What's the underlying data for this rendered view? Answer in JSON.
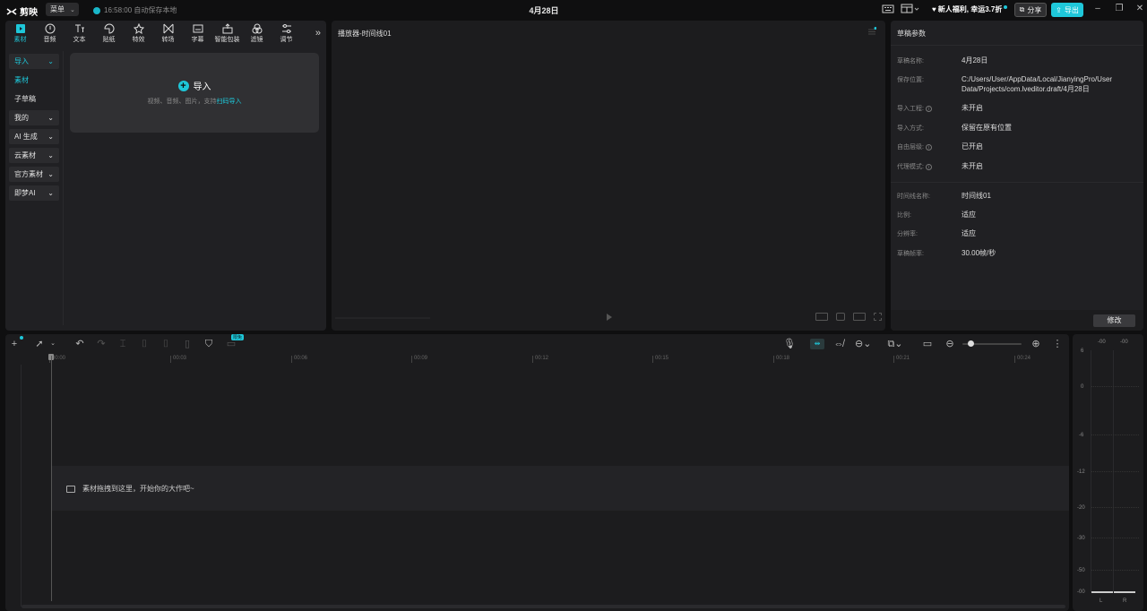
{
  "titlebar": {
    "app_name": "剪映",
    "menu_label": "菜单",
    "autosave_text": "16:58:00 自动保存本地",
    "doc_title": "4月28日",
    "promo_text": "新人福利, 幸运3.7折",
    "share_label": "分享",
    "export_label": "导出"
  },
  "toolbar": {
    "tools": [
      {
        "label": "素材",
        "icon": "media-icon"
      },
      {
        "label": "音频",
        "icon": "audio-icon"
      },
      {
        "label": "文本",
        "icon": "text-icon"
      },
      {
        "label": "贴纸",
        "icon": "sticker-icon"
      },
      {
        "label": "特效",
        "icon": "effects-icon"
      },
      {
        "label": "转场",
        "icon": "transition-icon"
      },
      {
        "label": "字幕",
        "icon": "subtitle-icon"
      },
      {
        "label": "智能包装",
        "icon": "smart-pack-icon"
      },
      {
        "label": "滤镜",
        "icon": "filter-icon"
      },
      {
        "label": "调节",
        "icon": "adjust-icon"
      }
    ],
    "more_label": "»"
  },
  "sidebar": {
    "items": [
      {
        "label": "导入",
        "style": "boxed-teal",
        "chevron": "⌄"
      },
      {
        "label": "素材",
        "style": "teal",
        "chevron": ""
      },
      {
        "label": "子草稿",
        "style": "plain",
        "chevron": ""
      },
      {
        "label": "我的",
        "style": "boxed",
        "chevron": "⌄"
      },
      {
        "label": "AI 生成",
        "style": "boxed",
        "chevron": "⌄"
      },
      {
        "label": "云素材",
        "style": "boxed",
        "chevron": "⌄"
      },
      {
        "label": "官方素材",
        "style": "boxed",
        "chevron": "⌄"
      },
      {
        "label": "即梦AI",
        "style": "boxed",
        "chevron": "⌄"
      }
    ]
  },
  "import_box": {
    "title": "导入",
    "subtitle_prefix": "视频、音频、图片，支持",
    "subtitle_link": "扫码导入"
  },
  "player": {
    "title": "播放器-时间线01"
  },
  "props": {
    "title": "草稿参数",
    "rows": [
      {
        "label": "草稿名称:",
        "value": "4月28日",
        "info": false
      },
      {
        "label": "保存位置:",
        "value": "C:/Users/User/AppData/Local/JianyingPro/User Data/Projects/com.lveditor.draft/4月28日",
        "info": false
      },
      {
        "label": "导入工程:",
        "value": "未开启",
        "info": true
      },
      {
        "label": "导入方式:",
        "value": "保留在原有位置",
        "info": false
      },
      {
        "label": "自由层级:",
        "value": "已开启",
        "info": true
      },
      {
        "label": "代理模式:",
        "value": "未开启",
        "info": true
      },
      {
        "label": "时间线名称:",
        "value": "时间线01",
        "info": false
      },
      {
        "label": "比例:",
        "value": "适应",
        "info": false
      },
      {
        "label": "分辨率:",
        "value": "适应",
        "info": false
      },
      {
        "label": "草稿帧率:",
        "value": "30.00帧/秒",
        "info": false
      }
    ],
    "modify_label": "修改"
  },
  "timeline": {
    "new_badge": "限免",
    "ticks": [
      "00:00",
      "00:03",
      "00:06",
      "00:09",
      "00:12",
      "00:15",
      "00:18",
      "00:21",
      "00:24"
    ],
    "drop_hint": "素材拖拽到这里，开始你的大作吧~"
  },
  "meter": {
    "top_left": "-00",
    "top_right": "-00",
    "scale": [
      "6",
      "0",
      "-6",
      "-12",
      "-20",
      "-30",
      "-50",
      "-00"
    ],
    "channel_left": "L",
    "channel_right": "R"
  },
  "colors": {
    "accent": "#1ec7d9",
    "panel_bg": "#202023",
    "app_bg": "#0f0f10"
  }
}
